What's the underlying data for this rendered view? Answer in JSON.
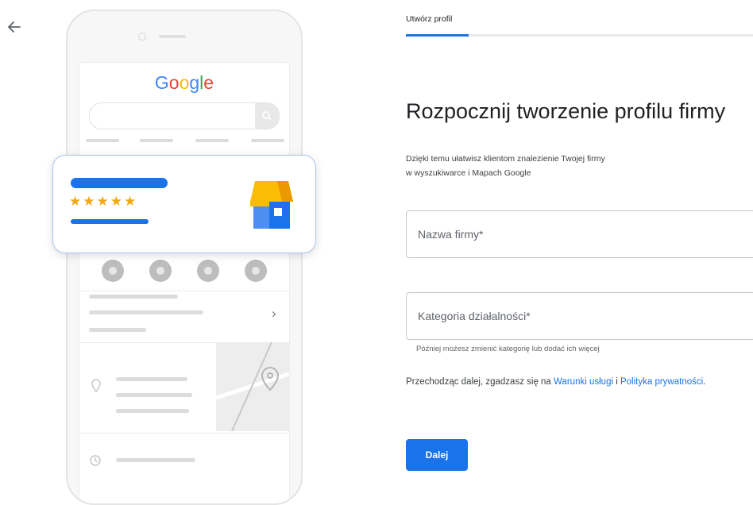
{
  "nav": {
    "back_icon": "arrow-back-icon"
  },
  "illustration": {
    "logo_text": "Google",
    "logo_colors": [
      "#4285F4",
      "#EA4335",
      "#FBBC05",
      "#4285F4",
      "#34A853",
      "#EA4335"
    ],
    "rating_stars": "★★★★★",
    "star_color": "#F3A712",
    "store_icon": "storefront-icon"
  },
  "form": {
    "step_tab_label": "Utwórz profil",
    "heading": "Rozpocznij tworzenie profilu firmy",
    "description_line1": "Dzięki temu ułatwisz klientom znalezienie Twojej firmy",
    "description_line2": "w wyszukiwarce i Mapach Google",
    "business_name": {
      "placeholder": "Nazwa firmy*",
      "value": ""
    },
    "category": {
      "placeholder": "Kategoria działalności*",
      "value": ""
    },
    "category_helper": "Później możesz zmienić kategorię lub dodać ich więcej",
    "terms_prefix": "Przechodząc dalej, zgadzasz się na ",
    "terms_link": "Warunki usługi",
    "terms_and": " i ",
    "privacy_link": "Polityka prywatności",
    "terms_suffix": ".",
    "next_label": "Dalej"
  },
  "colors": {
    "accent": "#1a73e8",
    "progress_track": "#e8eaed"
  }
}
